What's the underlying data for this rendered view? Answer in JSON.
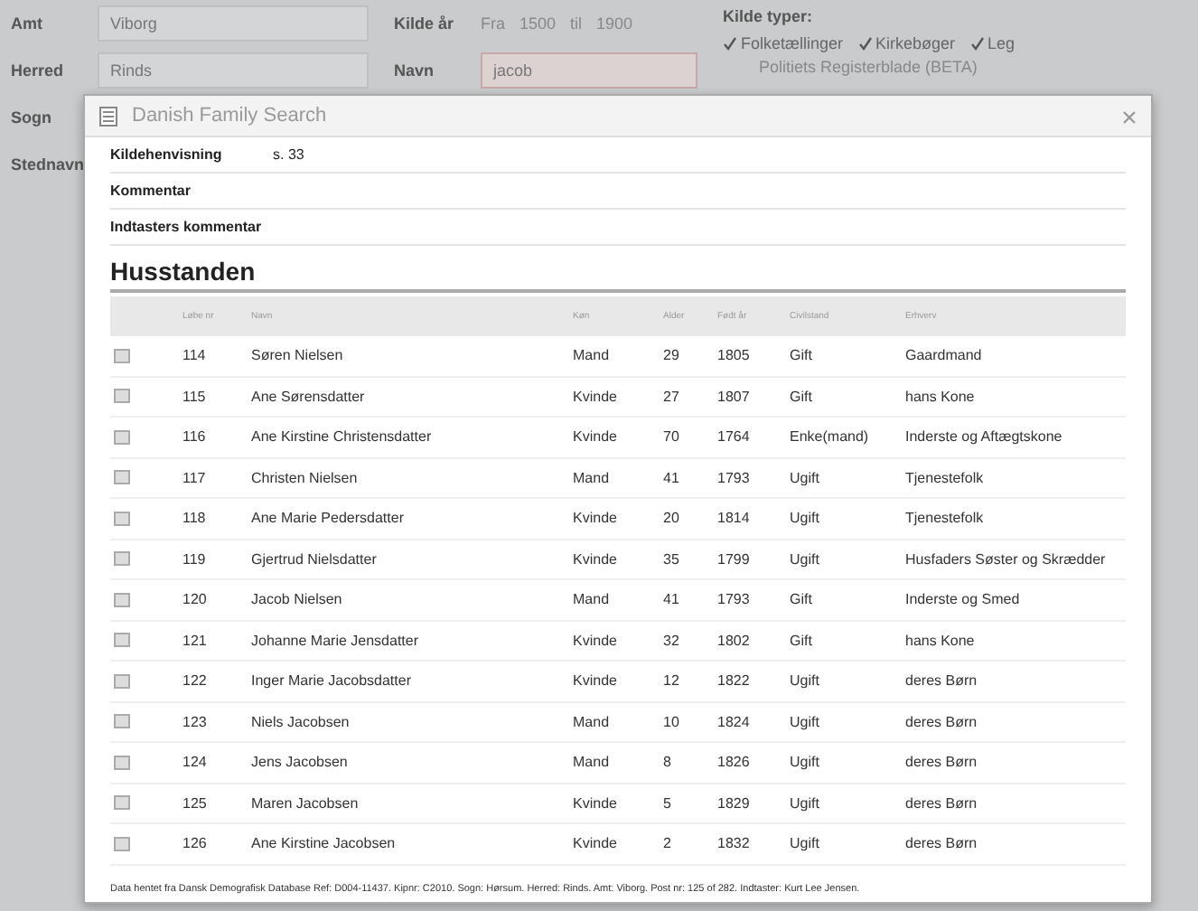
{
  "search_form": {
    "fields": [
      {
        "label": "Amt",
        "value": "Viborg"
      },
      {
        "label": "Herred",
        "value": "Rinds"
      },
      {
        "label": "Sogn"
      },
      {
        "label": "Stednavn"
      }
    ],
    "year": {
      "label": "Kilde år",
      "from_label": "Fra",
      "from": "1500",
      "to_label": "til",
      "to": "1900"
    },
    "name": {
      "label": "Navn",
      "value": "jacob"
    },
    "source_types": {
      "label": "Kilde typer:",
      "options": [
        {
          "label": "Folketællinger",
          "checked": true
        },
        {
          "label": "Kirkebøger",
          "checked": true
        },
        {
          "label": "Leg",
          "checked": true
        }
      ],
      "extra": "Politiets Registerblade (BETA)"
    }
  },
  "dialog": {
    "title": "Danish Family Search",
    "info_rows": [
      {
        "label": "Kildehenvisning",
        "value": "s. 33"
      },
      {
        "label": "Kommentar"
      },
      {
        "label": "Indtasters kommentar"
      }
    ],
    "section_title": "Husstanden",
    "columns": [
      "Løbe nr",
      "Navn",
      "Køn",
      "Alder",
      "Født år",
      "Civilstand",
      "Erhverv"
    ],
    "rows": [
      [
        "114",
        "Søren Nielsen",
        "Mand",
        "29",
        "1805",
        "Gift",
        "Gaardmand"
      ],
      [
        "115",
        "Ane Sørensdatter",
        "Kvinde",
        "27",
        "1807",
        "Gift",
        "hans Kone"
      ],
      [
        "116",
        "Ane Kirstine Christensdatter",
        "Kvinde",
        "70",
        "1764",
        "Enke(mand)",
        "Inderste og Aftægtskone"
      ],
      [
        "117",
        "Christen Nielsen",
        "Mand",
        "41",
        "1793",
        "Ugift",
        "Tjenestefolk"
      ],
      [
        "118",
        "Ane Marie Pedersdatter",
        "Kvinde",
        "20",
        "1814",
        "Ugift",
        "Tjenestefolk"
      ],
      [
        "119",
        "Gjertrud Nielsdatter",
        "Kvinde",
        "35",
        "1799",
        "Ugift",
        "Husfaders Søster og Skrædder"
      ],
      [
        "120",
        "Jacob Nielsen",
        "Mand",
        "41",
        "1793",
        "Gift",
        "Inderste og Smed"
      ],
      [
        "121",
        "Johanne Marie Jensdatter",
        "Kvinde",
        "32",
        "1802",
        "Gift",
        "hans Kone"
      ],
      [
        "122",
        "Inger Marie Jacobsdatter",
        "Kvinde",
        "12",
        "1822",
        "Ugift",
        "deres Børn"
      ],
      [
        "123",
        "Niels Jacobsen",
        "Mand",
        "10",
        "1824",
        "Ugift",
        "deres Børn"
      ],
      [
        "124",
        "Jens Jacobsen",
        "Mand",
        "8",
        "1826",
        "Ugift",
        "deres Børn"
      ],
      [
        "125",
        "Maren Jacobsen",
        "Kvinde",
        "5",
        "1829",
        "Ugift",
        "deres Børn"
      ],
      [
        "126",
        "Ane Kirstine Jacobsen",
        "Kvinde",
        "2",
        "1832",
        "Ugift",
        "deres Børn"
      ]
    ],
    "footer": "Data hentet fra Dansk Demografisk Database Ref: D004-11437. Kipnr: C2010. Sogn: Hørsum. Herred: Rinds. Amt: Viborg. Post nr: 125 of 282. Indtaster: Kurt Lee Jensen."
  }
}
